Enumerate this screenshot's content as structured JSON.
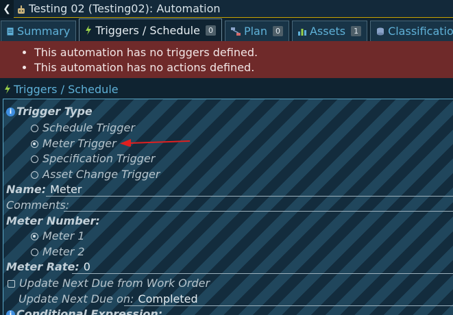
{
  "window": {
    "title": "Testing 02 (Testing02): Automation"
  },
  "tabs": [
    {
      "label": "Summary",
      "icon": "document-icon"
    },
    {
      "label": "Triggers / Schedule",
      "icon": "bolt-icon",
      "badge": "0"
    },
    {
      "label": "Plan",
      "icon": "flow-icon",
      "badge": "0"
    },
    {
      "label": "Assets",
      "icon": "bar-chart-icon",
      "badge": "1"
    },
    {
      "label": "Classification",
      "icon": "database-icon"
    }
  ],
  "errors": [
    "This automation has no triggers defined.",
    "This automation has no actions defined."
  ],
  "section": {
    "title": "Triggers / Schedule"
  },
  "form": {
    "trigger_type_label": "Trigger Type",
    "trigger_options": [
      "Schedule Trigger",
      "Meter Trigger",
      "Specification Trigger",
      "Asset Change Trigger"
    ],
    "trigger_selected": "Meter Trigger",
    "name_label": "Name:",
    "name_value": "Meter",
    "comments_label": "Comments:",
    "comments_value": "",
    "meter_number_label": "Meter Number:",
    "meter_options": [
      "Meter 1",
      "Meter 2"
    ],
    "meter_selected": "Meter 1",
    "meter_rate_label": "Meter Rate:",
    "meter_rate_value": "0",
    "update_next_due_label": "Update Next Due from Work Order",
    "update_next_due_checked": false,
    "update_next_due_on_label": "Update Next Due on:",
    "update_next_due_on_value": "Completed",
    "conditional_expression_label": "Conditional Expression:"
  },
  "colors": {
    "accent": "#5fb1d8",
    "error_bg": "#6f2a2a",
    "arrow": "#e02020",
    "title_border": "#c9a200"
  }
}
